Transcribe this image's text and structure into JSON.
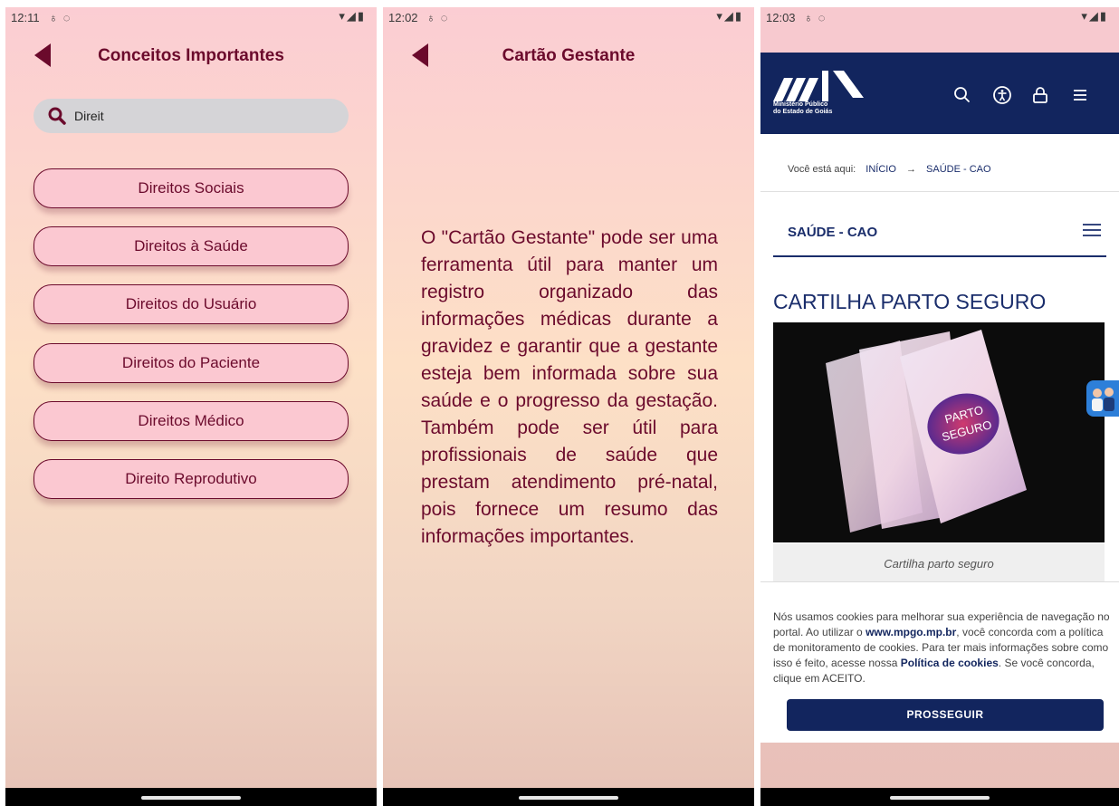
{
  "screen1": {
    "status": {
      "time": "12:11"
    },
    "title": "Conceitos Importantes",
    "search": {
      "value": "Direit"
    },
    "buttons": [
      "Direitos Sociais",
      "Direitos à Saúde",
      "Direitos do Usuário",
      "Direitos do Paciente",
      "Direitos Médico",
      "Direito Reprodutivo"
    ]
  },
  "screen2": {
    "status": {
      "time": "12:02"
    },
    "title": "Cartão Gestante",
    "body": "O \"Cartão Gestante\" pode ser uma ferramenta útil para manter um registro organizado das informações médicas durante a gravidez e garantir que a gestante esteja bem informada sobre sua saúde e o progresso da gestação. Também pode ser útil para profissionais de saúde que prestam atendimento pré-natal, pois fornece um resumo das informações importantes."
  },
  "screen3": {
    "status": {
      "time": "12:03"
    },
    "logo": {
      "line1": "Ministério Público",
      "line2": "do Estado de Goiás"
    },
    "breadcrumb": {
      "prefix": "Você está aqui:",
      "home": "INÍCIO",
      "arrow": "→",
      "current": "SAÚDE - CAO"
    },
    "section_title": "SAÚDE - CAO",
    "article_title": "CARTILHA PARTO SEGURO",
    "image_text": {
      "line1": "PARTO",
      "line2": "SEGURO"
    },
    "caption": "Cartilha parto seguro",
    "cookie": {
      "text1": "Nós usamos cookies para melhorar sua experiência de navegação no portal. Ao utilizar o ",
      "site": "www.mpgo.mp.br",
      "text2": ", você concorda com a política de monitoramento de cookies. Para ter mais informações sobre como isso é feito, acesse nossa ",
      "policy": "Política de cookies",
      "text3": ". Se você concorda, clique em ACEITO.",
      "button": "PROSSEGUIR"
    },
    "colors": {
      "header": "#12255e",
      "accent": "#1a2d6b"
    }
  },
  "colors": {
    "app_primary": "#6b0a2c",
    "button_fill": "#fbc8d1"
  }
}
